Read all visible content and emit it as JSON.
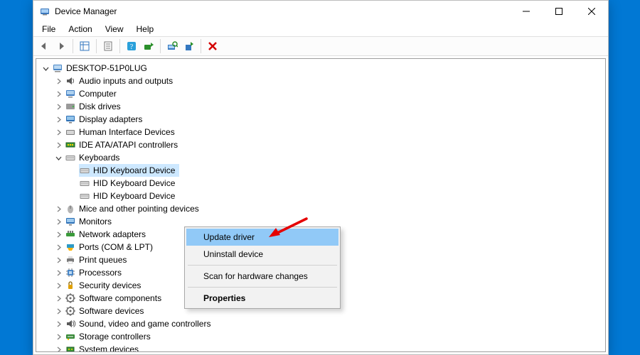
{
  "window": {
    "title": "Device Manager"
  },
  "menubar": {
    "items": [
      "File",
      "Action",
      "View",
      "Help"
    ]
  },
  "tree": {
    "root": "DESKTOP-51P0LUG",
    "nodes": [
      {
        "label": "Audio inputs and outputs",
        "icon": "audio"
      },
      {
        "label": "Computer",
        "icon": "computer"
      },
      {
        "label": "Disk drives",
        "icon": "disk"
      },
      {
        "label": "Display adapters",
        "icon": "display"
      },
      {
        "label": "Human Interface Devices",
        "icon": "hid"
      },
      {
        "label": "IDE ATA/ATAPI controllers",
        "icon": "ide"
      },
      {
        "label": "Keyboards",
        "icon": "keyboard",
        "expanded": true,
        "children": [
          {
            "label": "HID Keyboard Device",
            "icon": "keyboard",
            "selected": true
          },
          {
            "label": "HID Keyboard Device",
            "icon": "keyboard"
          },
          {
            "label": "HID Keyboard Device",
            "icon": "keyboard"
          }
        ]
      },
      {
        "label": "Mice and other pointing devices",
        "icon": "mouse"
      },
      {
        "label": "Monitors",
        "icon": "monitor"
      },
      {
        "label": "Network adapters",
        "icon": "network"
      },
      {
        "label": "Ports (COM & LPT)",
        "icon": "ports"
      },
      {
        "label": "Print queues",
        "icon": "printer"
      },
      {
        "label": "Processors",
        "icon": "cpu"
      },
      {
        "label": "Security devices",
        "icon": "security"
      },
      {
        "label": "Software components",
        "icon": "software"
      },
      {
        "label": "Software devices",
        "icon": "software"
      },
      {
        "label": "Sound, video and game controllers",
        "icon": "sound"
      },
      {
        "label": "Storage controllers",
        "icon": "storage"
      },
      {
        "label": "System devices",
        "icon": "system"
      }
    ]
  },
  "contextmenu": {
    "items": [
      {
        "label": "Update driver",
        "highlight": true
      },
      {
        "label": "Uninstall device"
      },
      {
        "sep": true
      },
      {
        "label": "Scan for hardware changes"
      },
      {
        "sep": true
      },
      {
        "label": "Properties",
        "bold": true
      }
    ]
  },
  "toolbar": {
    "buttons": [
      "back",
      "forward",
      "|",
      "show-hidden",
      "|",
      "properties",
      "|",
      "help",
      "update",
      "|",
      "scan",
      "enable",
      "|",
      "uninstall"
    ]
  }
}
